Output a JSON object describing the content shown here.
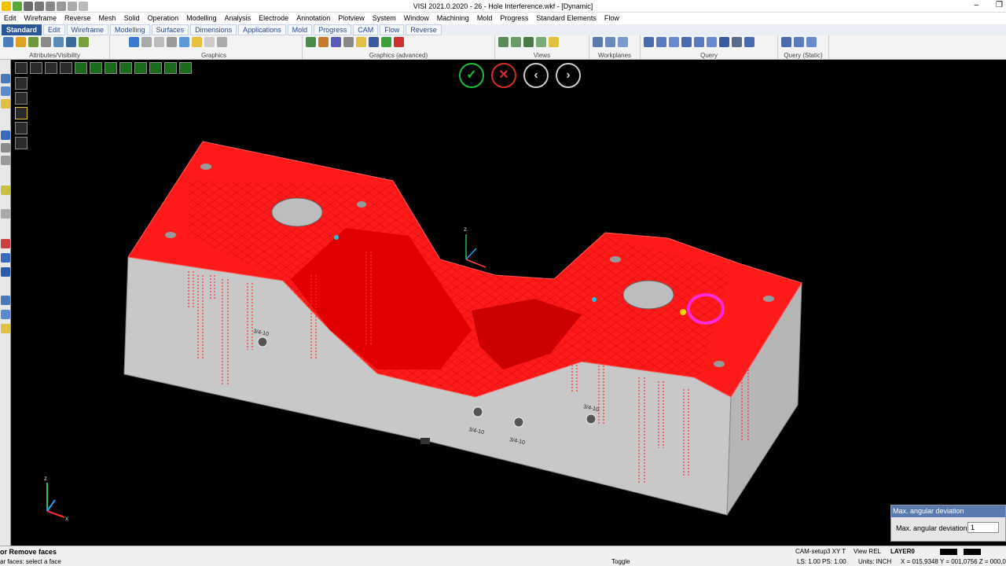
{
  "window": {
    "title": "VISI 2021.0.2020 - 26 - Hole Interference.wkf - [Dynamic]"
  },
  "menu": [
    "Edit",
    "Wireframe",
    "Reverse",
    "Mesh",
    "Solid",
    "Operation",
    "Modelling",
    "Analysis",
    "Electrode",
    "Annotation",
    "Plotview",
    "System",
    "Window",
    "Machining",
    "Mold",
    "Progress",
    "Standard Elements",
    "Flow"
  ],
  "tabs": [
    "Standard",
    "Edit",
    "Wireframe",
    "Modelling",
    "Surfaces",
    "Dimensions",
    "Applications",
    "Mold",
    "Progress",
    "CAM",
    "Flow",
    "Reverse"
  ],
  "ribbon_groups": [
    "Attributes/Visibility",
    "Graphics",
    "Graphics (advanced)",
    "Views",
    "Workplanes",
    "Query",
    "Query (Static)"
  ],
  "viewport": {
    "axis_label_z": "z",
    "axis_label_x": "x",
    "hole_labels": [
      "3/4-10",
      "3/4-10",
      "3/4-10",
      "3/4-10"
    ]
  },
  "angular_panel": {
    "title": "Max. angular deviation",
    "label": "Max. angular deviation",
    "value": "1"
  },
  "status": {
    "command": "or Remove faces",
    "prompt": "ar faces: select a face",
    "toggle": "Toggle",
    "workplane": "CAM-setup3 XY T",
    "view": "View REL",
    "layer": "LAYER0",
    "scale": "LS: 1.00 PS: 1.00",
    "units": "Units: INCH",
    "coords": "X = 015,9348 Y = 001,0756 Z = 000,0"
  },
  "colors": {
    "model_red": "#ff1a1a",
    "model_grey": "#c8c8c8",
    "highlight": "#ff2bd6",
    "ok": "#1dbf3a",
    "cancel": "#d62b2b"
  }
}
